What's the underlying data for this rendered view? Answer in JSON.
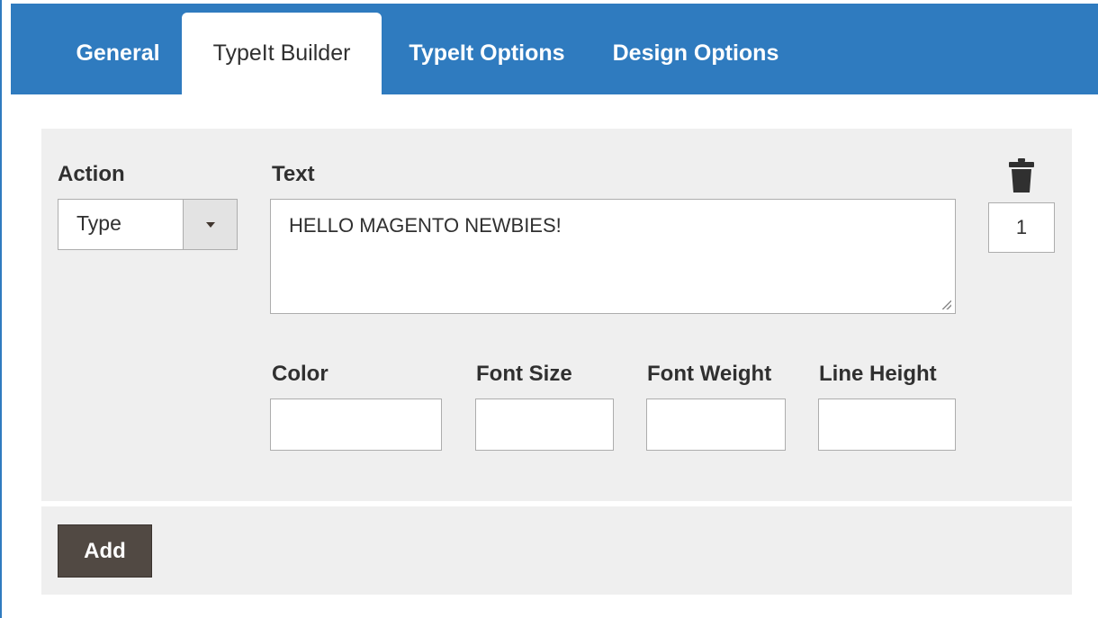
{
  "tabs": [
    {
      "label": "General",
      "active": false
    },
    {
      "label": "TypeIt Builder",
      "active": true
    },
    {
      "label": "TypeIt Options",
      "active": false
    },
    {
      "label": "Design Options",
      "active": false
    }
  ],
  "row": {
    "action_label": "Action",
    "action_value": "Type",
    "text_label": "Text",
    "text_value": "HELLO MAGENTO NEWBIES!",
    "order_value": "1",
    "color_label": "Color",
    "color_value": "",
    "font_size_label": "Font Size",
    "font_size_value": "",
    "font_weight_label": "Font Weight",
    "font_weight_value": "",
    "line_height_label": "Line Height",
    "line_height_value": ""
  },
  "add_label": "Add",
  "icons": {
    "delete": "trash-icon",
    "dropdown": "caret-down-icon"
  },
  "colors": {
    "tab_bar": "#2f7bbf",
    "button": "#514943",
    "panel": "#efefef"
  }
}
